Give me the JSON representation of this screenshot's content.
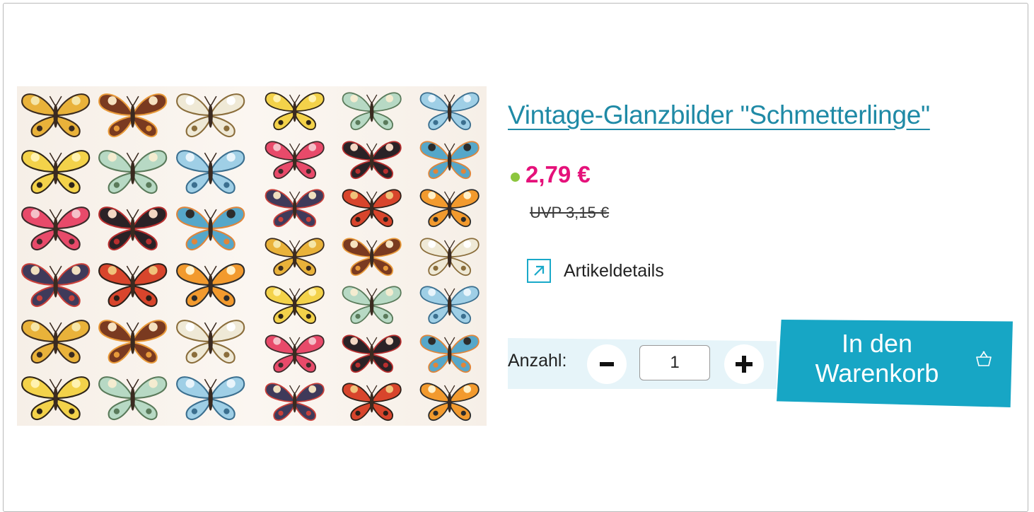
{
  "product": {
    "image_alt": "Vintage-Glanzbilder Schmetterlinge",
    "title": "Vintage-Glanzbilder \"Schmetterlinge\"",
    "price": "2,79 €",
    "uvp": "UVP 3,15 €",
    "availability_color": "#8cc63e",
    "details_label": "Artikeldetails",
    "details_icon": "external-arrow-icon"
  },
  "cart": {
    "quantity_label": "Anzahl:",
    "quantity_value": "1",
    "minus_icon": "minus-icon",
    "plus_icon": "plus-icon",
    "button_label_line1": "In den",
    "button_label_line2": "Warenkorb",
    "button_icon": "basket-icon"
  },
  "colors": {
    "accent": "#17a6c5",
    "title": "#1f8aa6",
    "price": "#e5117a",
    "panel": "#e6f4f9"
  }
}
